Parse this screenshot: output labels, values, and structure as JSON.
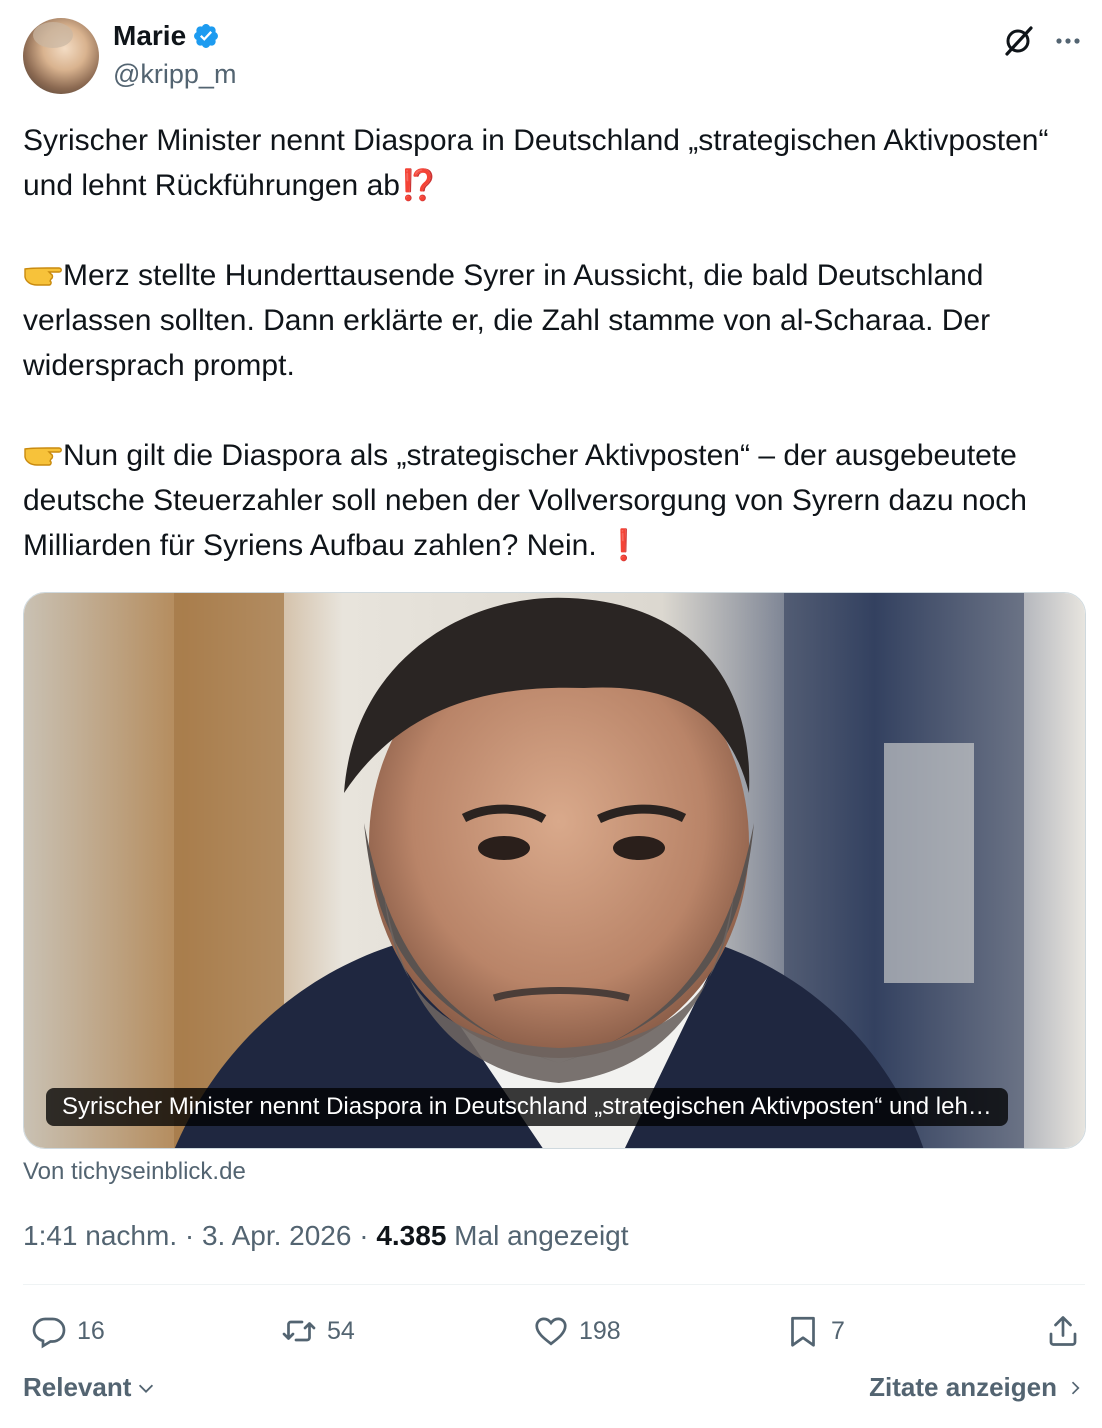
{
  "author": {
    "name": "Marie",
    "handle": "@kripp_m",
    "verified": true,
    "verified_color": "#1d9bf0"
  },
  "tweet": {
    "line1": "Syrischer Minister nennt Diaspora in Deutschland „strategischen Aktivposten“ und lehnt Rückführungen ab",
    "line1_emoji": "⁉️",
    "para2": "Merz stellte Hunderttausende Syrer in Aussicht, die bald Deutschland verlassen sollten. Dann erklärte er, die Zahl stamme von al-Scharaa. Der widersprach prompt.",
    "para3": "Nun gilt die Diaspora als „strategischer Aktivposten“ – der ausgebeutete deutsche Steuerzahler soll neben der Vollversorgung von Syrern dazu noch Milliarden für Syriens Aufbau zahlen? Nein. ",
    "para3_emoji": "❗",
    "point_emoji": "backhand-index-pointing-right"
  },
  "card": {
    "caption": "Syrischer Minister nennt Diaspora in Deutschland „strategischen Aktivposten“ und leh…",
    "source": "Von tichyseinblick.de"
  },
  "meta": {
    "time_date": "1:41 nachm. · 3. Apr. 2026 · ",
    "views": "4.385",
    "views_label": " Mal angezeigt"
  },
  "actions": {
    "replies": "16",
    "reposts": "54",
    "likes": "198",
    "bookmarks": "7"
  },
  "footer": {
    "sort_label": "Relevant",
    "quotes_label": "Zitate anzeigen"
  }
}
